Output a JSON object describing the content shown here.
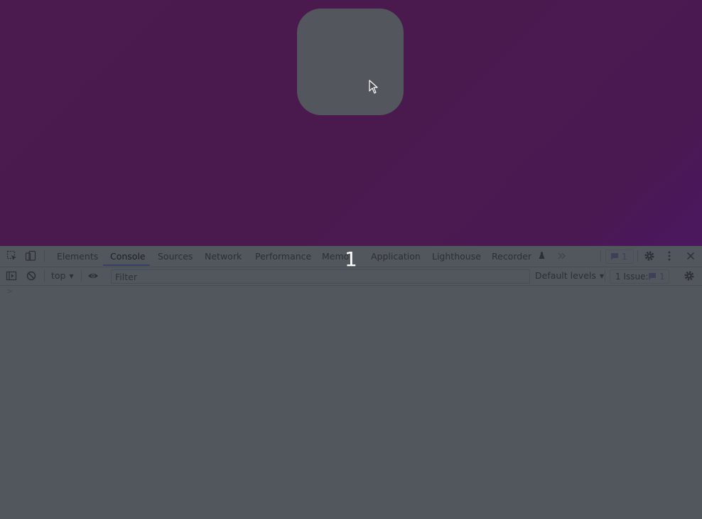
{
  "page": {
    "overlay_counter": "1"
  },
  "devtools": {
    "tabs": [
      {
        "label": "Elements",
        "active": false
      },
      {
        "label": "Console",
        "active": true
      },
      {
        "label": "Sources",
        "active": false
      },
      {
        "label": "Network",
        "active": false
      },
      {
        "label": "Performance",
        "active": false
      },
      {
        "label": "Memo",
        "active": false
      },
      {
        "label": "Application",
        "active": false
      },
      {
        "label": "Lighthouse",
        "active": false
      },
      {
        "label": "Recorder",
        "active": false
      }
    ],
    "more_tabs_icon": "double-chevron-right-icon",
    "issues_badge_count": "1",
    "console": {
      "context_label": "top",
      "filter_placeholder": "Filter",
      "levels_label": "Default levels",
      "issues_label": "1 Issue:",
      "issues_count": "1",
      "prompt_symbol": ">"
    }
  },
  "colors": {
    "page_background": "#4a1a4e",
    "square": "#53575d",
    "devtools_background": "#52565d",
    "active_tab_underline": "#3a3f6a",
    "issue_accent": "#3e4058"
  }
}
